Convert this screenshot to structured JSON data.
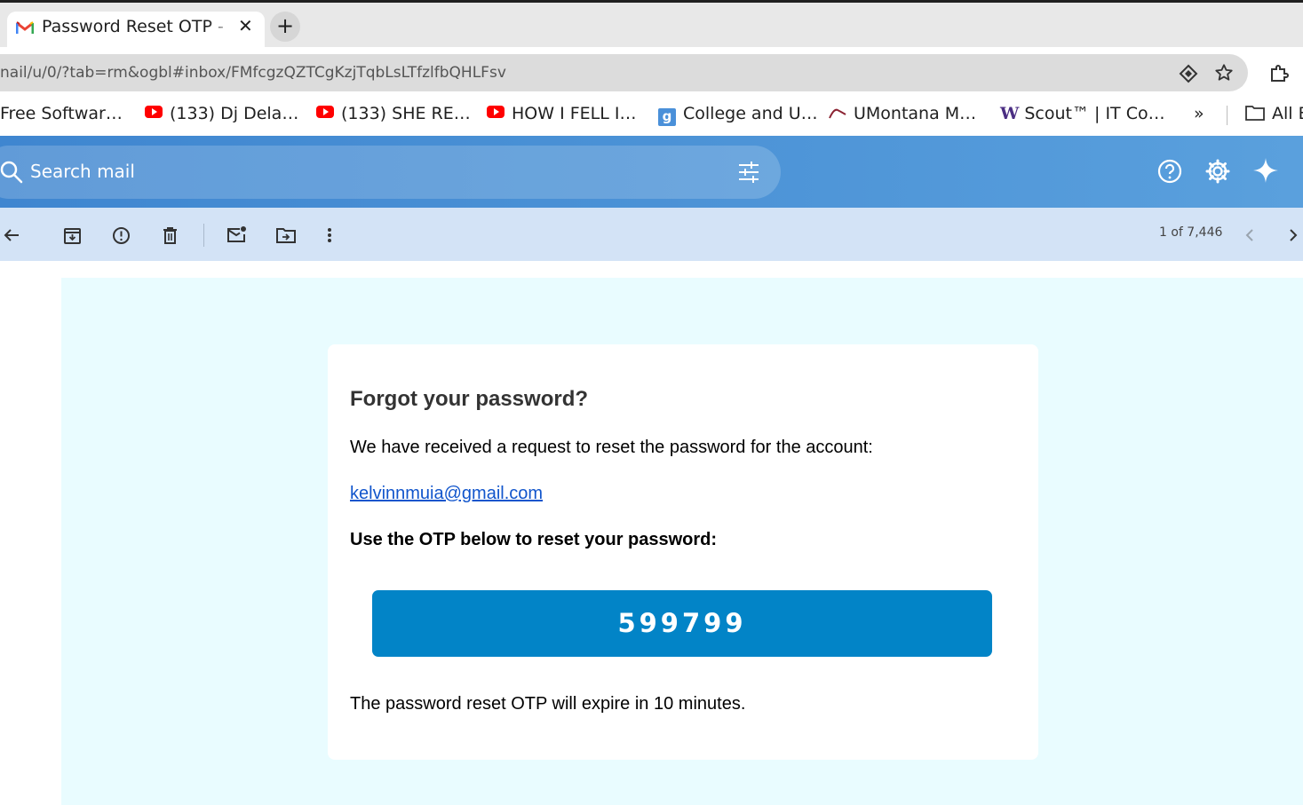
{
  "browser": {
    "tab_title": "Password Reset OTP - k",
    "tab_favicon": "gmail-icon",
    "url": "nail/u/0/?tab=rm&ogbl#inbox/FMfcgzQZTCgKzjTqbLsLTfzlfbQHLFsv",
    "bookmarks": [
      {
        "label": "Free Softwar…",
        "icon": "none"
      },
      {
        "label": "(133) Dj Dela…",
        "icon": "youtube-icon"
      },
      {
        "label": "(133) SHE RE…",
        "icon": "youtube-icon"
      },
      {
        "label": "HOW I FELL I…",
        "icon": "youtube-icon"
      },
      {
        "label": "College and U…",
        "icon": "g-icon"
      },
      {
        "label": "UMontana M…",
        "icon": "umontana-icon"
      },
      {
        "label": "Scout™ | IT Co…",
        "icon": "w-icon"
      }
    ],
    "overflow": "»",
    "all_bookmarks": "All B"
  },
  "gmail": {
    "search_placeholder": "Search mail",
    "pagination": "1 of 7,446"
  },
  "email": {
    "heading": "Forgot your password?",
    "intro": "We have received a request to reset the password for the account:",
    "account_email": "kelvinnmuia@gmail.com",
    "instruction": "Use the OTP below to reset your password:",
    "otp": "599799",
    "expiry_note": "The password reset OTP will expire in 10 minutes."
  },
  "colors": {
    "header_blue": "#4b92d6",
    "toolbar_blue": "#d3e3f6",
    "mail_bg": "#e9fcff",
    "otp_blue": "#0284c7",
    "link": "#1155cc"
  }
}
